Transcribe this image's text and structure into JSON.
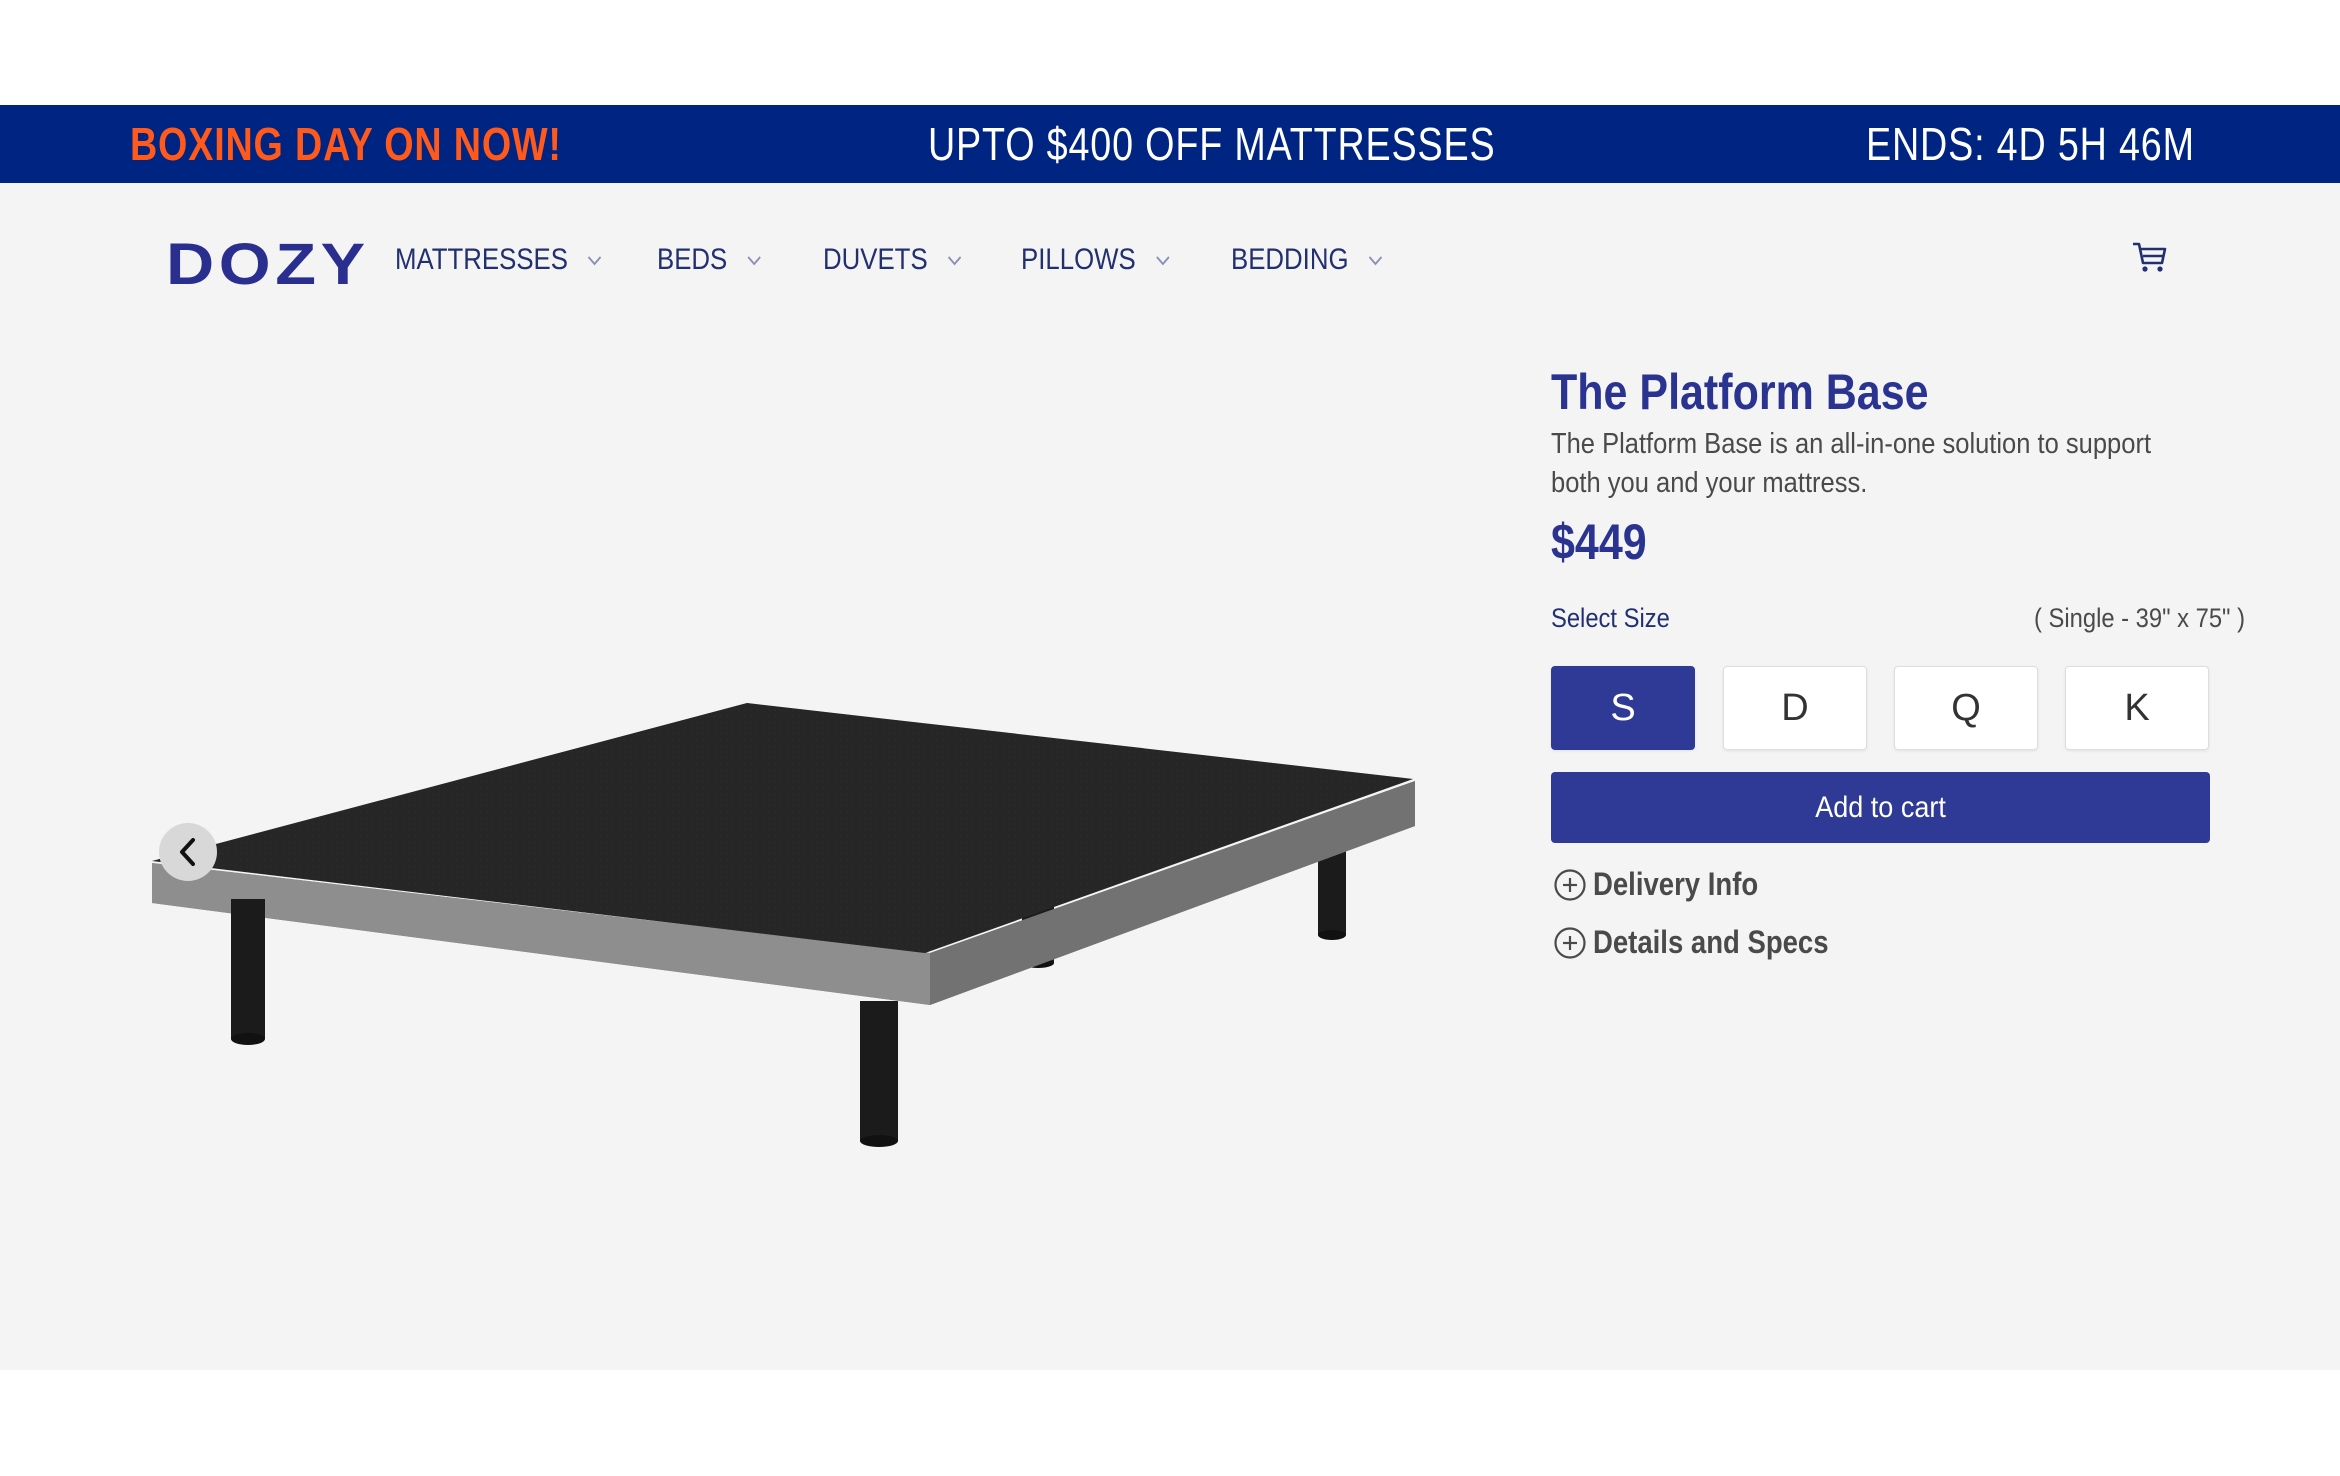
{
  "promo": {
    "left_text": "BOXING DAY ON NOW!",
    "center_text": "UPTO $400 OFF MATTRESSES",
    "right_text": "ENDS: 4D 5H 46M"
  },
  "nav": {
    "logo": "DOZY",
    "items": [
      {
        "label": "MATTRESSES"
      },
      {
        "label": "BEDS"
      },
      {
        "label": "DUVETS"
      },
      {
        "label": "PILLOWS"
      },
      {
        "label": "BEDDING"
      }
    ],
    "cart_icon": "cart-icon"
  },
  "product": {
    "title": "The Platform Base",
    "description": "The Platform Base is an all-in-one solution to support both you and your mattress.",
    "price": "$449",
    "size_label": "Select Size",
    "selected_size_text": "( Single - 39\" x 75\" )",
    "sizes": [
      {
        "label": "S",
        "selected": true
      },
      {
        "label": "D",
        "selected": false
      },
      {
        "label": "Q",
        "selected": false
      },
      {
        "label": "K",
        "selected": false
      }
    ],
    "add_to_cart_label": "Add to cart",
    "accordions": [
      {
        "label": "Delivery Info",
        "icon": "plus-circle-icon"
      },
      {
        "label": "Details and Specs",
        "icon": "plus-circle-icon"
      }
    ]
  },
  "colors": {
    "promo_bg": "#002482",
    "promo_accent": "#ff5a1b",
    "brand": "#2e3a95",
    "page_bg": "#f4f4f4"
  }
}
